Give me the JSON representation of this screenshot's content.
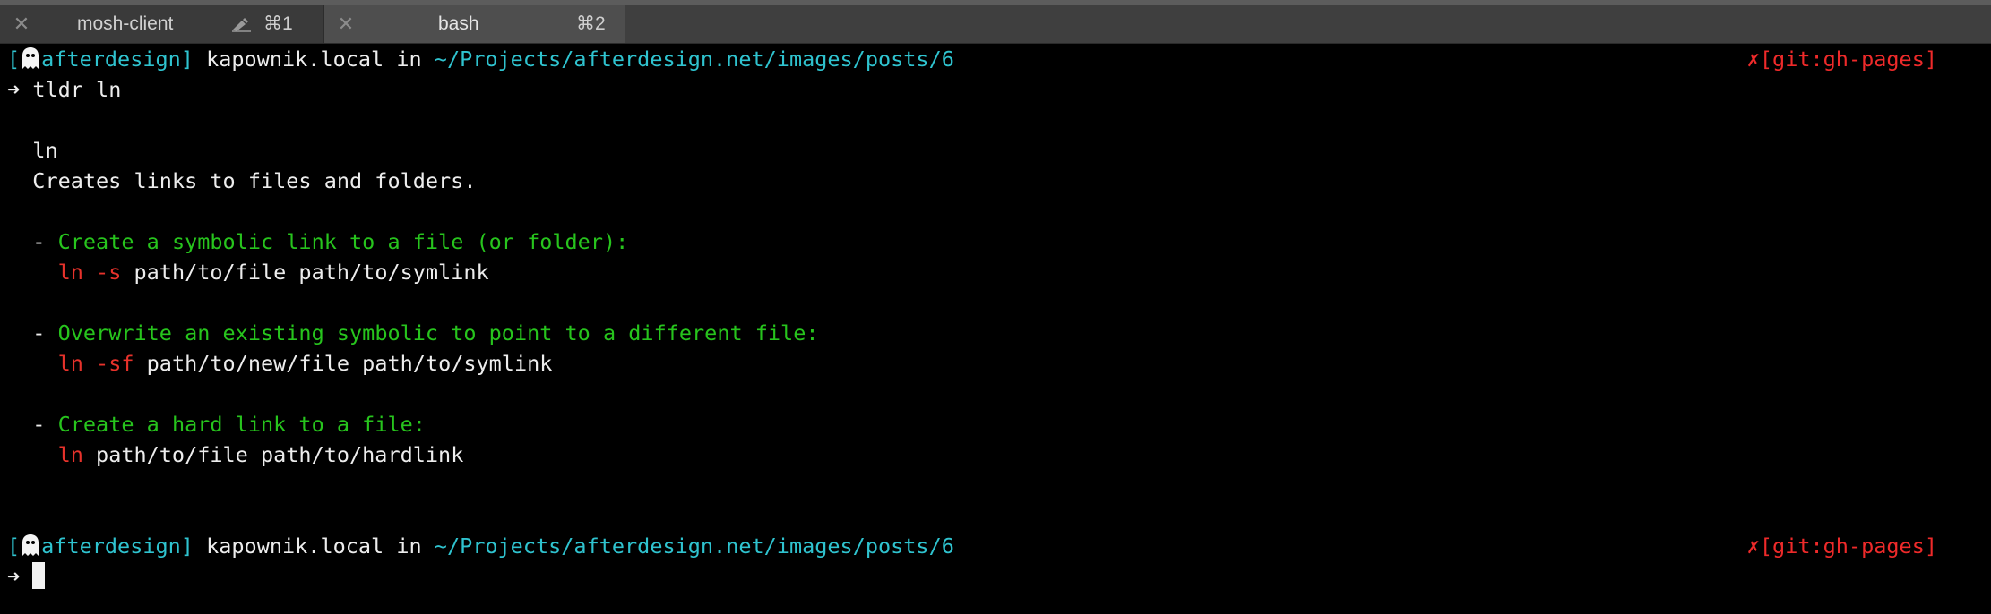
{
  "tabs": [
    {
      "title": "mosh-client",
      "shortcut": "⌘1",
      "active": false
    },
    {
      "title": "bash",
      "shortcut": "⌘2",
      "active": true
    }
  ],
  "prompt": {
    "bracket_open": "[",
    "user": "afterdesign",
    "bracket_close": "]",
    "host": "kapownik.local",
    "in_word": "in",
    "path": "~/Projects/afterdesign.net/images/posts/6",
    "git_status": "✗[git:gh-pages]",
    "arrow": "➜"
  },
  "command": "tldr ln",
  "output": {
    "name": "ln",
    "description": "Creates links to files and folders.",
    "examples": [
      {
        "dash": "-",
        "text": "Create a symbolic link to a file (or folder):",
        "cmd": "ln",
        "flag": "-s",
        "args": "path/to/file path/to/symlink"
      },
      {
        "dash": "-",
        "text": "Overwrite an existing symbolic to point to a different file:",
        "cmd": "ln",
        "flag": "-sf",
        "args": "path/to/new/file path/to/symlink"
      },
      {
        "dash": "-",
        "text": "Create a hard link to a file:",
        "cmd": "ln",
        "flag": "",
        "args": "path/to/file path/to/hardlink"
      }
    ]
  },
  "colors": {
    "background": "#000000",
    "prompt_cyan": "#2fc3cf",
    "example_green": "#27c41d",
    "command_red": "#e7322b",
    "git_red": "#ee2a2a",
    "text": "#ededed"
  },
  "icons": {
    "tab_close": "close-icon",
    "tab_edit": "pencil-icon",
    "prompt_ghost": "ghost-icon"
  }
}
